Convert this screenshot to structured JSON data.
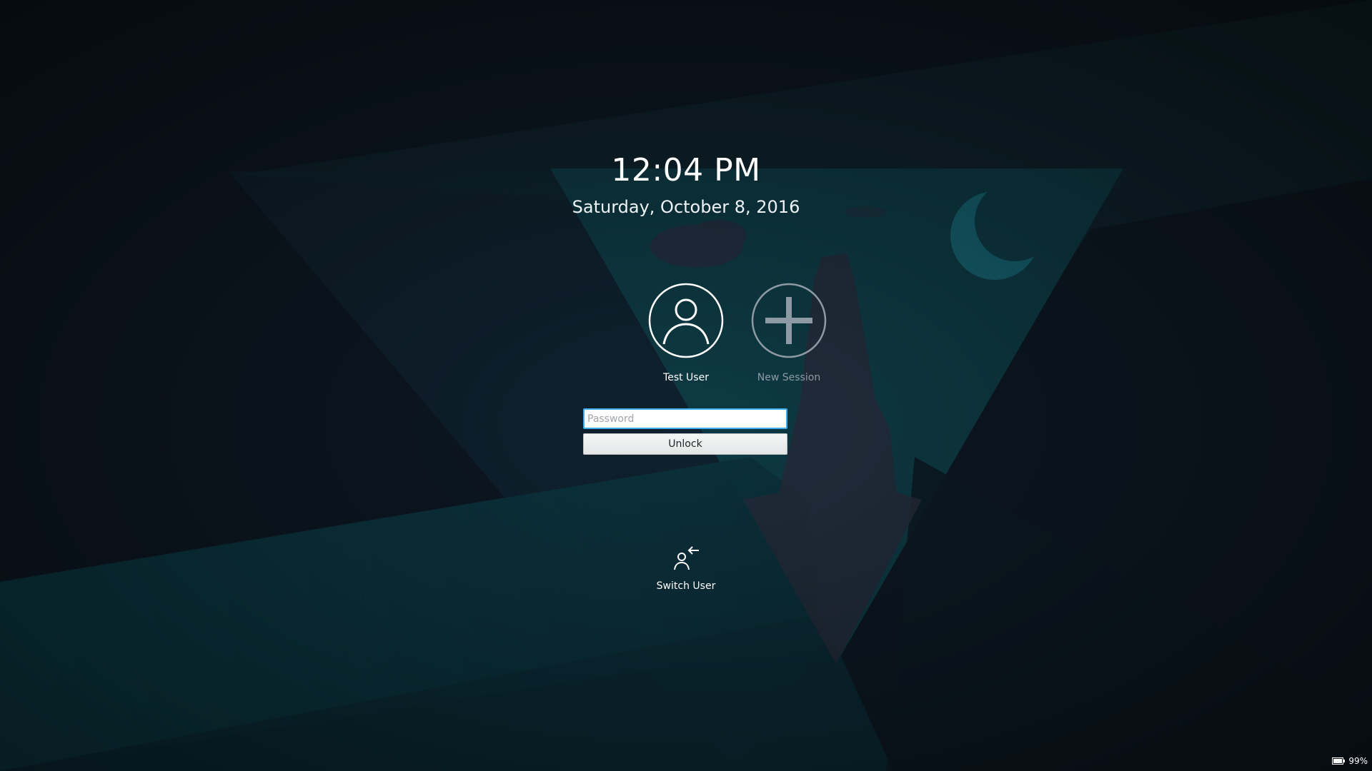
{
  "lockscreen": {
    "time": "12:04 PM",
    "date": "Saturday, October 8, 2016"
  },
  "users": [
    {
      "name": "Test User",
      "icon": "user-icon",
      "selected": true
    },
    {
      "name": "New Session",
      "icon": "plus-icon",
      "selected": false
    }
  ],
  "login": {
    "password_placeholder": "Password",
    "password_value": "",
    "unlock_label": "Unlock"
  },
  "actions": {
    "switch_user_label": "Switch User",
    "switch_user_icon": "switch-user-icon"
  },
  "status": {
    "battery_icon": "battery-icon",
    "battery_percent": "99%"
  },
  "colors": {
    "accent": "#3daee9",
    "background": "#0e1a26",
    "wallpaper_teal": "#0e3a44",
    "moon": "#15606e"
  }
}
